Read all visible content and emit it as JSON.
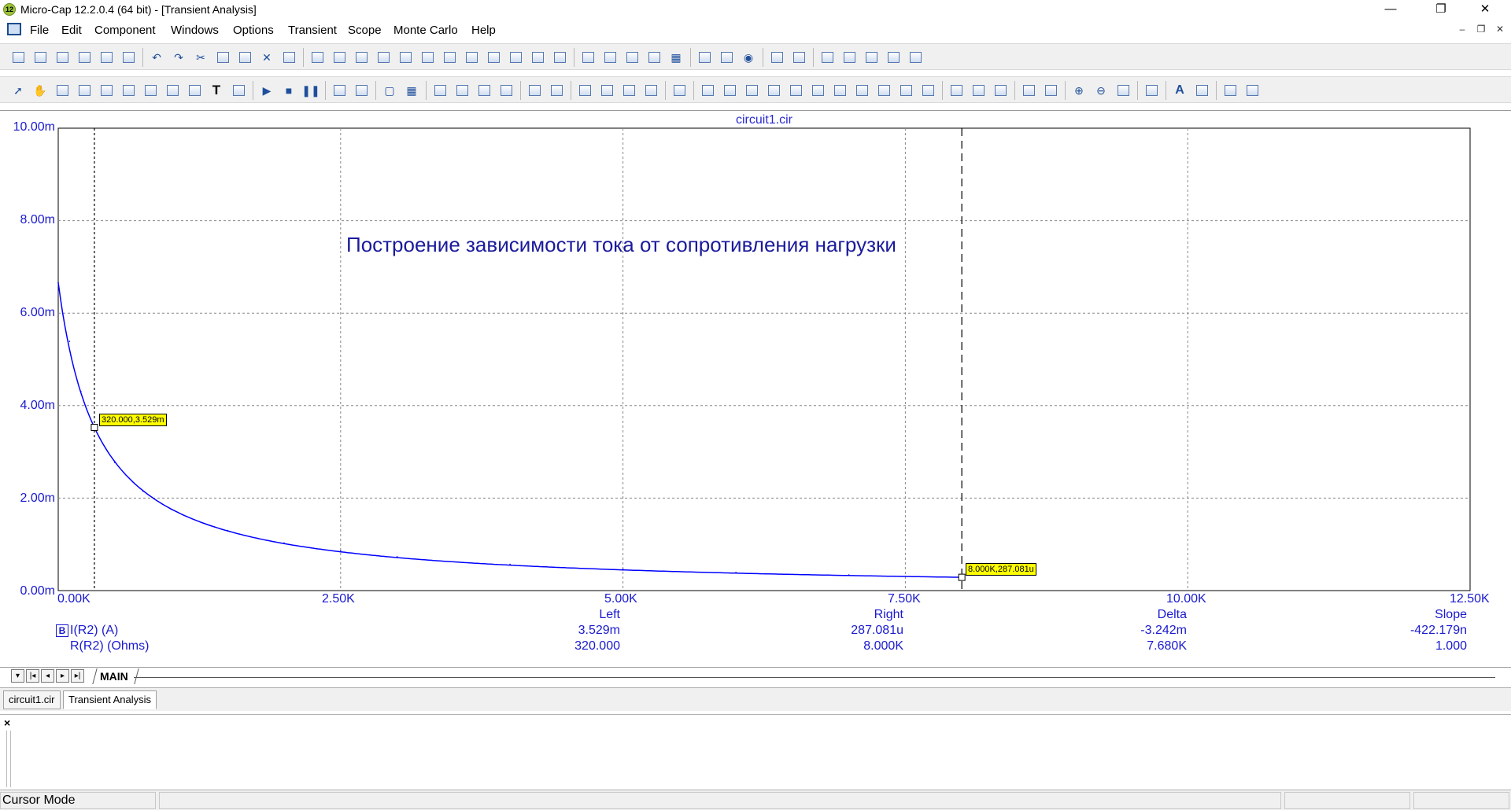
{
  "window": {
    "title": "Micro-Cap 12.2.0.4 (64 bit) - [Transient Analysis]",
    "app_icon_text": "12",
    "minimize_glyph": "—",
    "restore_glyph": "❐",
    "close_glyph": "✕"
  },
  "menu": {
    "items": [
      "File",
      "Edit",
      "Component",
      "Windows",
      "Options",
      "Transient",
      "Scope",
      "Monte Carlo",
      "Help"
    ],
    "mdi_minimize": "–",
    "mdi_restore": "❐",
    "mdi_close": "✕"
  },
  "toolbar1": {
    "icons": [
      "new-file-icon",
      "open-file-icon",
      "save-icon",
      "save-all-icon",
      "print-preview-icon",
      "print-icon",
      "undo-icon",
      "redo-icon",
      "cut-icon",
      "copy-icon",
      "paste-icon",
      "delete-icon",
      "select-all-icon",
      "ground-icon",
      "resistor-icon",
      "capacitor-icon",
      "inductor-icon",
      "diode-icon",
      "transistor-icon",
      "opamp-icon",
      "subckt-icon",
      "battery-icon",
      "source-icon",
      "switch-icon",
      "cascade-icon",
      "tile-vertical-icon",
      "tile-horizontal-icon",
      "window-icon",
      "window2-icon",
      "calculator-icon",
      "component-panel-icon",
      "parts-icon",
      "globe-icon",
      "probe-icon",
      "report-icon",
      "steps-icon",
      "options-icon",
      "tools-icon",
      "analysis-icon",
      "fft-icon"
    ]
  },
  "toolbar2": {
    "icons": [
      "select-arrow-icon",
      "pan-icon",
      "component-mode-icon",
      "scale-mode-icon",
      "plot-properties-icon",
      "plot2-icon",
      "plot3-icon",
      "plot4-icon",
      "plot5-icon",
      "text-mode-icon",
      "clipboard-icon",
      "run-icon",
      "stop-icon",
      "pause-icon",
      "add-curve-icon",
      "remove-curve-icon",
      "frame-icon",
      "grid-icon",
      "bar1-icon",
      "bar2-icon",
      "bar3-icon",
      "bar4-icon",
      "h-split-icon",
      "v-split-icon",
      "zoom-fit-icon",
      "zoom-area-icon",
      "zoom-prev-icon",
      "zoom-reset-icon",
      "properties-icon",
      "cursor-next-icon",
      "cursor-prev-icon",
      "peak-icon",
      "valley-icon",
      "high-icon",
      "low-icon",
      "inflection-icon",
      "global-high-icon",
      "global-low-icon",
      "top-icon",
      "bottom-icon",
      "paste-dropdown-icon",
      "format-icon",
      "calendar-icon",
      "tag-left-icon",
      "tag-right-icon",
      "zoom-in-icon",
      "zoom-out-icon",
      "zoom-restore-icon",
      "grid-dropdown-icon",
      "font-icon",
      "text-style-icon",
      "tile1-icon",
      "tile2-icon"
    ],
    "text_mode_glyph": "T",
    "font_glyph": "A"
  },
  "plot": {
    "file_title": "circuit1.cir",
    "annotation": "Построение зависимости тока от сопротивления нагрузки",
    "y_tick_labels": [
      "10.00m",
      "8.00m",
      "6.00m",
      "4.00m",
      "2.00m",
      "0.00m"
    ],
    "x_tick_labels": [
      "0.00K",
      "2.50K",
      "5.00K",
      "7.50K",
      "10.00K",
      "12.50K"
    ],
    "left_cursor_tag": "320.000,3.529m",
    "right_cursor_tag": "8.000K,287.081u",
    "curve_color": "#0000ff",
    "axis_color": "#1a1acf"
  },
  "chart_data": {
    "type": "line",
    "title": "circuit1.cir",
    "xlabel": "R(R2) (Ohms)",
    "ylabel": "I(R2) (A)",
    "xlim": [
      0,
      12500
    ],
    "ylim": [
      0,
      0.01
    ],
    "grid": true,
    "series": [
      {
        "name": "I(R2) (A)",
        "x": [
          0,
          100,
          200,
          320,
          500,
          750,
          1000,
          1500,
          2000,
          2500,
          3000,
          4000,
          5000,
          6000,
          7000,
          8000
        ],
        "y": [
          0.00666,
          0.00539,
          0.00431,
          0.003529,
          0.00277,
          0.00215,
          0.00176,
          0.0013,
          0.00103,
          0.000857,
          0.000733,
          0.000569,
          0.000465,
          0.000393,
          0.00034,
          0.000287081
        ]
      }
    ],
    "cursors": [
      {
        "x": 320,
        "y": 0.003529,
        "label": "320.000,3.529m"
      },
      {
        "x": 8000,
        "y": 0.000287081,
        "label": "8.000K,287.081u"
      }
    ]
  },
  "readout": {
    "headers": [
      "Left",
      "Right",
      "Delta",
      "Slope"
    ],
    "rows": [
      {
        "name": "I(R2) (A)",
        "values": [
          "3.529m",
          "287.081u",
          "-3.242m",
          "-422.179n"
        ]
      },
      {
        "name": "R(R2) (Ohms)",
        "values": [
          "320.000",
          "8.000K",
          "7.680K",
          "1.000"
        ]
      }
    ],
    "row_icon_glyph": "B"
  },
  "page_tabs": {
    "nav": [
      "▾",
      "|◂",
      "◂",
      "▸",
      "▸|"
    ],
    "main_tab": "MAIN"
  },
  "doc_tabs": [
    "circuit1.cir",
    "Transient Analysis"
  ],
  "output": {
    "close_glyph": "×"
  },
  "status": {
    "mode": "Cursor Mode"
  }
}
